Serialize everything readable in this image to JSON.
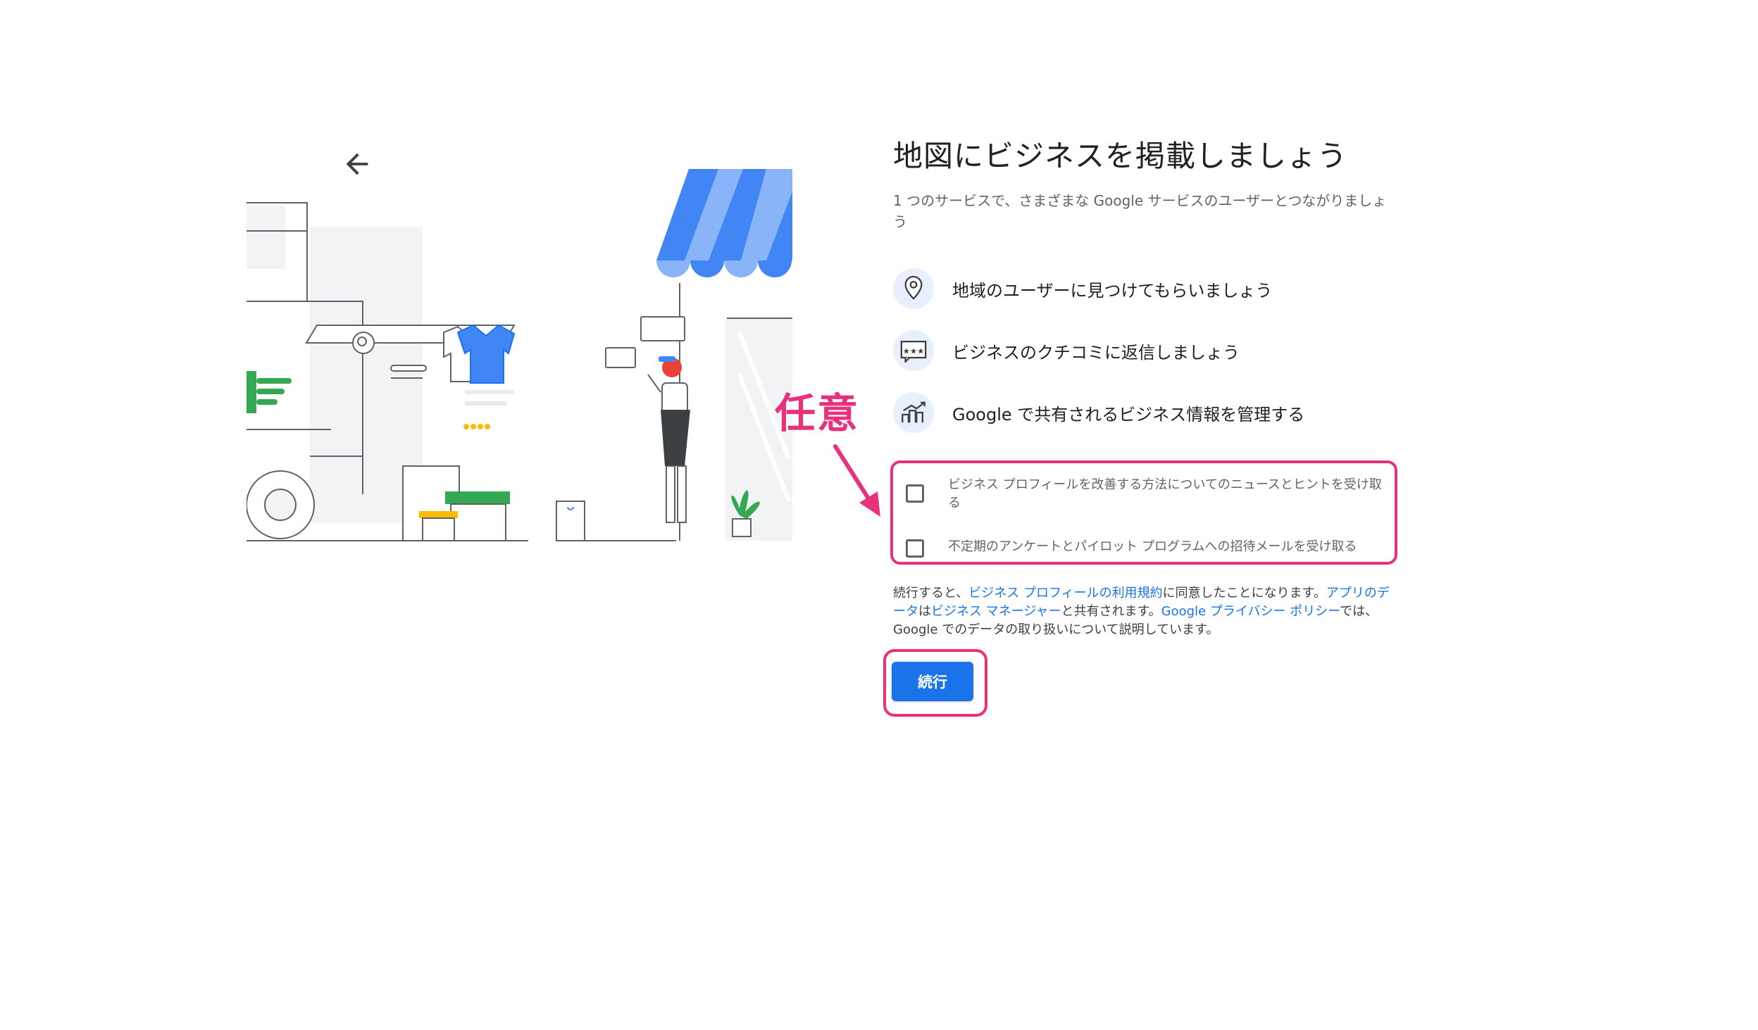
{
  "header": {
    "back_icon": "arrow-left-icon",
    "title": "地図にビジネスを掲載しましょう",
    "subtitle": "1 つのサービスで、さまざまな Google サービスのユーザーとつながりましょう"
  },
  "features": [
    {
      "icon": "map-pin-icon",
      "label": "地域のユーザーに見つけてもらいましょう"
    },
    {
      "icon": "review-bubble-icon",
      "label": "ビジネスのクチコミに返信しましょう"
    },
    {
      "icon": "growth-chart-icon",
      "label": "Google で共有されるビジネス情報を管理する"
    }
  ],
  "annotation": {
    "label": "任意",
    "color": "#e8317a"
  },
  "options": [
    {
      "label": "ビジネス プロフィールを改善する方法についてのニュースとヒントを受け取る",
      "checked": false
    },
    {
      "label": "不定期のアンケートとパイロット プログラムへの招待メールを受け取る",
      "checked": false
    }
  ],
  "legal": {
    "t1": "続行すると、",
    "link1": "ビジネス プロフィールの利用規約",
    "t2": "に同意したことになります。",
    "link2": "アプリのデータ",
    "t3": "は",
    "link3": "ビジネス マネージャー",
    "t4": "と共有されます。",
    "link4": "Google プライバシー ポリシー",
    "t5": "では、Google でのデータの取り扱いについて説明しています。"
  },
  "continue_label": "続行",
  "colors": {
    "accent": "#1a73e8",
    "annotation": "#e8317a",
    "icon_bg": "#e8f0fe"
  }
}
